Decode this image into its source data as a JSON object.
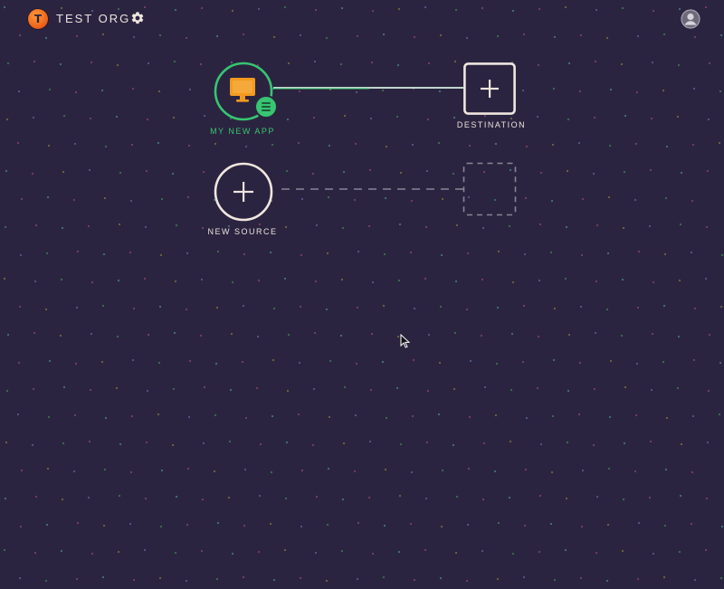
{
  "header": {
    "org_name": "TEST ORG",
    "org_logo_letter": "T",
    "settings_icon": "gear-icon",
    "user_icon": "user-avatar-icon"
  },
  "pipeline": {
    "source": {
      "label": "MY NEW APP",
      "icon": "monitor-icon",
      "badge_icon": "list-icon",
      "status": "connected"
    },
    "destination": {
      "label": "DESTINATION",
      "icon": "plus-icon"
    },
    "new_source": {
      "label": "NEW SOURCE",
      "icon": "plus-icon"
    },
    "placeholder_destination": {
      "icon": "dashed-box"
    }
  },
  "colors": {
    "background": "#2b2440",
    "accent_green": "#37c571",
    "accent_orange": "#f39a1e",
    "foreground": "#efe6de",
    "muted": "#8a8495"
  }
}
